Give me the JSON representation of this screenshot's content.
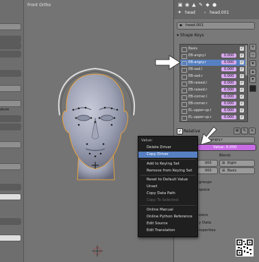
{
  "viewport": {
    "label": "Front Ortho"
  },
  "left_panel": {
    "labels": [
      "ature"
    ]
  },
  "properties_header": {
    "breadcrumb_object": "head",
    "breadcrumb_mesh": "head.001",
    "datablock_name": "head.001"
  },
  "shape_keys": {
    "title": "Shape Keys",
    "items": [
      {
        "name": "Basis",
        "value": ""
      },
      {
        "name": "EB-angry.l",
        "value": "0.000"
      },
      {
        "name": "EB-angry.r",
        "value": "0.000"
      },
      {
        "name": "EB-sad.l",
        "value": "0.000"
      },
      {
        "name": "EB-sad.r",
        "value": "0.000"
      },
      {
        "name": "EB-raised.l",
        "value": "0.000"
      },
      {
        "name": "EB-raised.r",
        "value": "0.000"
      },
      {
        "name": "EB-corner.l",
        "value": "0.000"
      },
      {
        "name": "EB-corner.r",
        "value": "0.000"
      },
      {
        "name": "EL-upper-up.l",
        "value": "0.000"
      },
      {
        "name": "EL-upper-up.r",
        "value": "0.000"
      }
    ],
    "selected_index": 2,
    "relative_label": "Relative",
    "active_key_name": "EB-angry.r",
    "value_field": "Value: 0.000",
    "blend_label": "Blend:",
    "blend_value": "Right",
    "blend_basis": "Basis",
    "range_values": [
      "000",
      "000"
    ]
  },
  "background_labels": [
    "groups",
    "space",
    "olors",
    "y Data",
    "roperties"
  ],
  "context_menu": {
    "title": "Value:",
    "items": [
      {
        "label": "Delete Driver",
        "state": "normal"
      },
      {
        "label": "Copy Driver",
        "state": "highlighted"
      },
      {
        "label": "Add to Keying Set",
        "state": "normal"
      },
      {
        "label": "Remove from Keying Set",
        "state": "normal"
      },
      {
        "label": "Reset to Default Value",
        "state": "normal"
      },
      {
        "label": "Unset",
        "state": "normal"
      },
      {
        "label": "Copy Data Path",
        "state": "normal"
      },
      {
        "label": "Copy To Selected",
        "state": "disabled"
      },
      {
        "label": "Online Manual",
        "state": "normal"
      },
      {
        "label": "Online Python Reference",
        "state": "normal"
      },
      {
        "label": "Edit Source",
        "state": "normal"
      },
      {
        "label": "Edit Translation",
        "state": "normal"
      }
    ]
  },
  "colors": {
    "selection": "#5680c2",
    "value_field": "#d8a8ef",
    "value_field_active": "#c86ce4",
    "menu_bg": "#1f1f1f",
    "mesh_outline": "#e8a23c"
  }
}
